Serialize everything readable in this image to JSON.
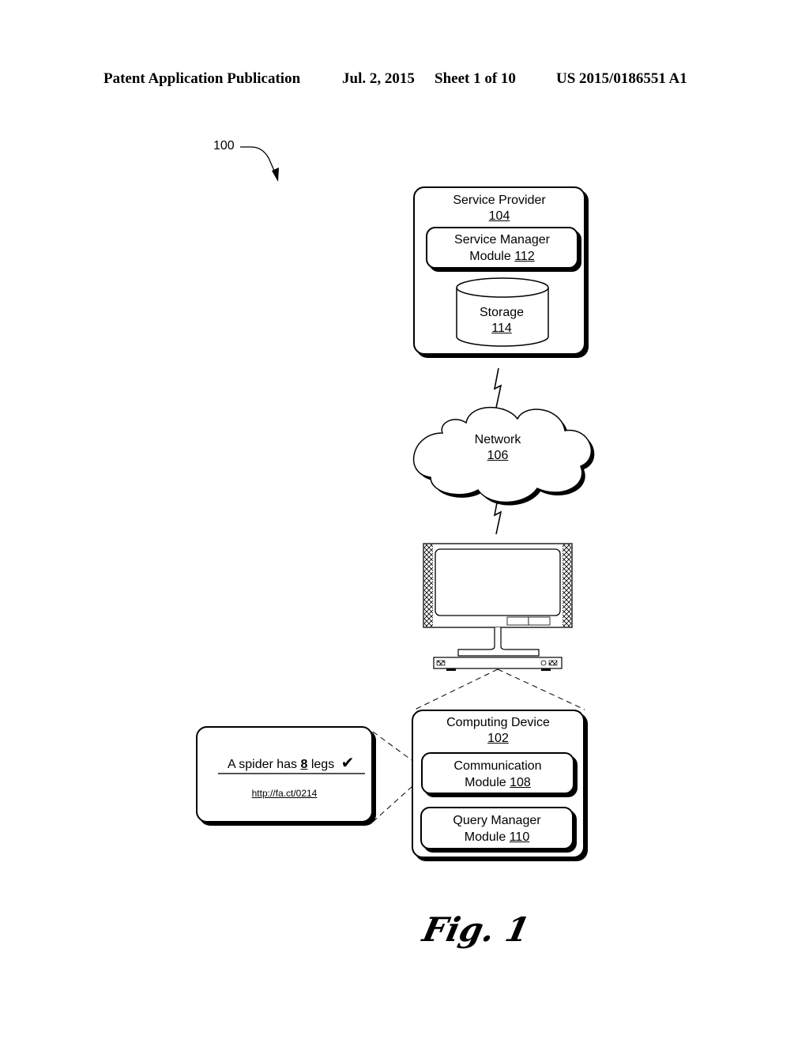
{
  "header": {
    "publication": "Patent Application Publication",
    "date": "Jul. 2, 2015",
    "sheet": "Sheet 1 of 10",
    "number": "US 2015/0186551 A1"
  },
  "figure": {
    "ref": "100",
    "caption": "Fig. 1"
  },
  "service_provider": {
    "title": "Service Provider",
    "ref": "104",
    "service_manager": {
      "line1": "Service Manager",
      "line2": "Module",
      "ref": "112"
    },
    "storage": {
      "title": "Storage",
      "ref": "114"
    }
  },
  "network": {
    "title": "Network",
    "ref": "106"
  },
  "computing_device": {
    "title": "Computing Device",
    "ref": "102",
    "communication": {
      "line1": "Communication",
      "line2": "Module",
      "ref": "108"
    },
    "query_manager": {
      "line1": "Query Manager",
      "line2": "Module",
      "ref": "110"
    }
  },
  "callout": {
    "text_before": "A spider has ",
    "highlight": "8",
    "text_after": " legs",
    "check": "✔",
    "link": "http://fa.ct/0214"
  }
}
